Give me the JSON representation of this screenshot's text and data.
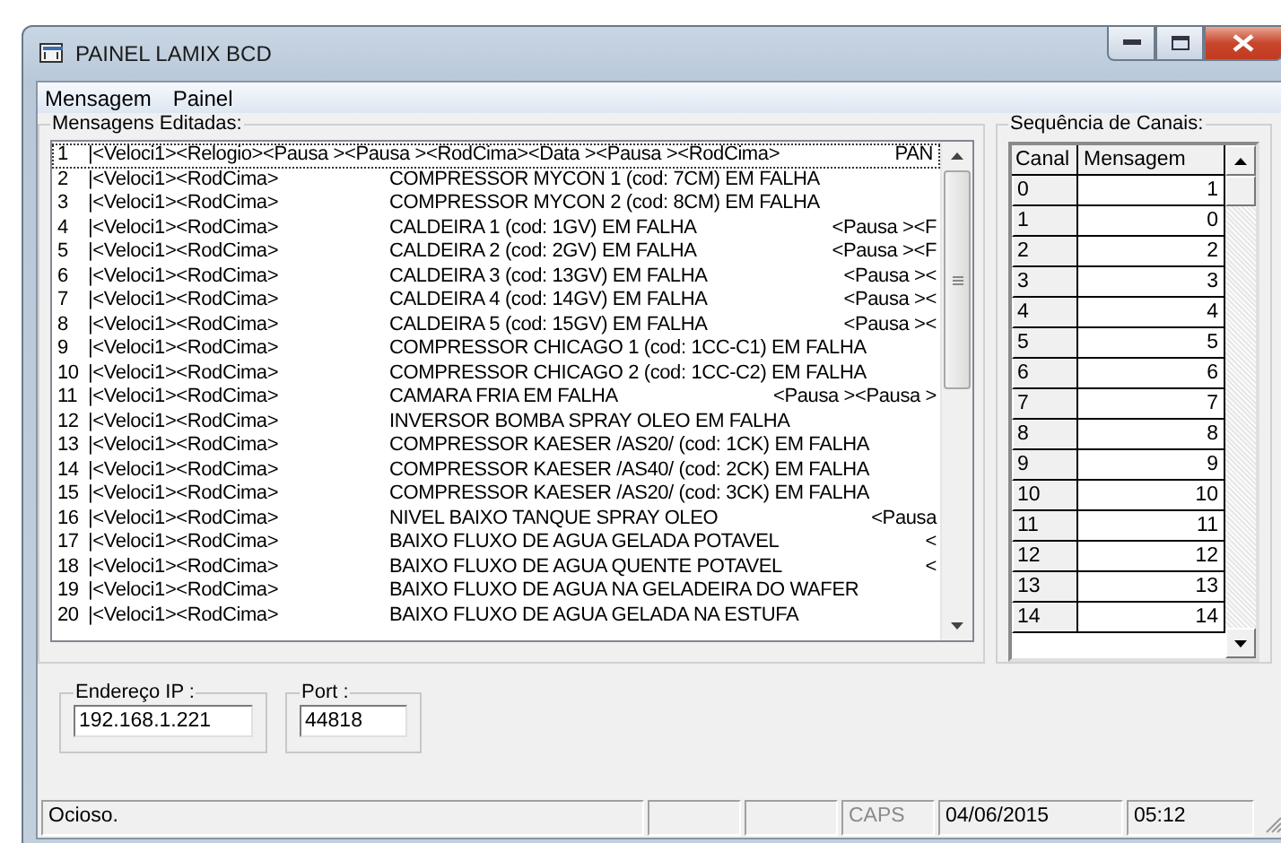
{
  "window": {
    "title": "PAINEL LAMIX BCD"
  },
  "menu": [
    "Mensagem",
    "Painel"
  ],
  "messages_group": {
    "label": "Mensagens Editadas:",
    "rows": [
      {
        "number": "1",
        "codes": "|<Veloci1><Relogio><Pausa ><Pausa ><RodCima><Data ><Pausa ><RodCima>",
        "text": "PAN",
        "tail": "",
        "selected": true
      },
      {
        "number": "2",
        "codes": "|<Veloci1><RodCima>",
        "text": "COMPRESSOR MYCON 1 (cod: 7CM) EM FALHA",
        "tail": "",
        "selected": false
      },
      {
        "number": "3",
        "codes": "|<Veloci1><RodCima>",
        "text": "COMPRESSOR MYCON 2 (cod: 8CM) EM FALHA",
        "tail": "",
        "selected": false
      },
      {
        "number": "4",
        "codes": "|<Veloci1><RodCima>",
        "text": "CALDEIRA 1 (cod: 1GV) EM FALHA",
        "tail": "<Pausa ><F",
        "selected": false
      },
      {
        "number": "5",
        "codes": "|<Veloci1><RodCima>",
        "text": "CALDEIRA 2 (cod: 2GV) EM FALHA",
        "tail": "<Pausa ><F",
        "selected": false
      },
      {
        "number": "6",
        "codes": "|<Veloci1><RodCima>",
        "text": "CALDEIRA 3 (cod: 13GV) EM FALHA",
        "tail": "<Pausa ><",
        "selected": false
      },
      {
        "number": "7",
        "codes": "|<Veloci1><RodCima>",
        "text": "CALDEIRA 4 (cod: 14GV) EM FALHA",
        "tail": "<Pausa ><",
        "selected": false
      },
      {
        "number": "8",
        "codes": "|<Veloci1><RodCima>",
        "text": "CALDEIRA 5 (cod: 15GV) EM FALHA",
        "tail": "<Pausa ><",
        "selected": false
      },
      {
        "number": "9",
        "codes": "|<Veloci1><RodCima>",
        "text": "COMPRESSOR CHICAGO 1 (cod: 1CC-C1) EM FALHA",
        "tail": "",
        "selected": false
      },
      {
        "number": "10",
        "codes": "|<Veloci1><RodCima>",
        "text": "COMPRESSOR CHICAGO 2 (cod: 1CC-C2) EM FALHA",
        "tail": "",
        "selected": false
      },
      {
        "number": "11",
        "codes": "|<Veloci1><RodCima>",
        "text": "CAMARA FRIA EM FALHA",
        "tail": "<Pausa ><Pausa >",
        "selected": false
      },
      {
        "number": "12",
        "codes": "|<Veloci1><RodCima>",
        "text": "INVERSOR BOMBA SPRAY OLEO EM FALHA",
        "tail": "",
        "selected": false
      },
      {
        "number": "13",
        "codes": "|<Veloci1><RodCima>",
        "text": "COMPRESSOR KAESER /AS20/ (cod: 1CK) EM FALHA",
        "tail": "",
        "selected": false
      },
      {
        "number": "14",
        "codes": "|<Veloci1><RodCima>",
        "text": "COMPRESSOR KAESER /AS40/ (cod: 2CK) EM FALHA",
        "tail": "",
        "selected": false
      },
      {
        "number": "15",
        "codes": "|<Veloci1><RodCima>",
        "text": "COMPRESSOR KAESER /AS20/ (cod: 3CK) EM FALHA",
        "tail": "",
        "selected": false
      },
      {
        "number": "16",
        "codes": "|<Veloci1><RodCima>",
        "text": "NIVEL BAIXO TANQUE SPRAY OLEO",
        "tail": "<Pausa",
        "selected": false
      },
      {
        "number": "17",
        "codes": "|<Veloci1><RodCima>",
        "text": "BAIXO FLUXO DE AGUA GELADA POTAVEL",
        "tail": "<",
        "selected": false
      },
      {
        "number": "18",
        "codes": "|<Veloci1><RodCima>",
        "text": "BAIXO FLUXO DE AGUA QUENTE POTAVEL",
        "tail": "<",
        "selected": false
      },
      {
        "number": "19",
        "codes": "|<Veloci1><RodCima>",
        "text": "BAIXO FLUXO DE AGUA NA GELADEIRA DO WAFER",
        "tail": "",
        "selected": false
      },
      {
        "number": "20",
        "codes": "|<Veloci1><RodCima>",
        "text": "BAIXO FLUXO DE AGUA GELADA NA ESTUFA",
        "tail": "",
        "selected": false
      }
    ]
  },
  "channels_group": {
    "label": "Sequência de Canais:",
    "columns": [
      "Canal",
      "Mensagem"
    ],
    "rows": [
      {
        "canal": "0",
        "mensagem": "1"
      },
      {
        "canal": "1",
        "mensagem": "0"
      },
      {
        "canal": "2",
        "mensagem": "2"
      },
      {
        "canal": "3",
        "mensagem": "3"
      },
      {
        "canal": "4",
        "mensagem": "4"
      },
      {
        "canal": "5",
        "mensagem": "5"
      },
      {
        "canal": "6",
        "mensagem": "6"
      },
      {
        "canal": "7",
        "mensagem": "7"
      },
      {
        "canal": "8",
        "mensagem": "8"
      },
      {
        "canal": "9",
        "mensagem": "9"
      },
      {
        "canal": "10",
        "mensagem": "10"
      },
      {
        "canal": "11",
        "mensagem": "11"
      },
      {
        "canal": "12",
        "mensagem": "12"
      },
      {
        "canal": "13",
        "mensagem": "13"
      },
      {
        "canal": "14",
        "mensagem": "14"
      }
    ]
  },
  "ip": {
    "label": "Endereço IP :",
    "value": "192.168.1.221"
  },
  "port": {
    "label": "Port :",
    "value": "44818"
  },
  "status_bar": [
    {
      "text": "Ocioso.",
      "disabled": false
    },
    {
      "text": "CAPS",
      "disabled": true
    },
    {
      "text": "04/06/2015",
      "disabled": false
    },
    {
      "text": "05:12",
      "disabled": false
    }
  ]
}
